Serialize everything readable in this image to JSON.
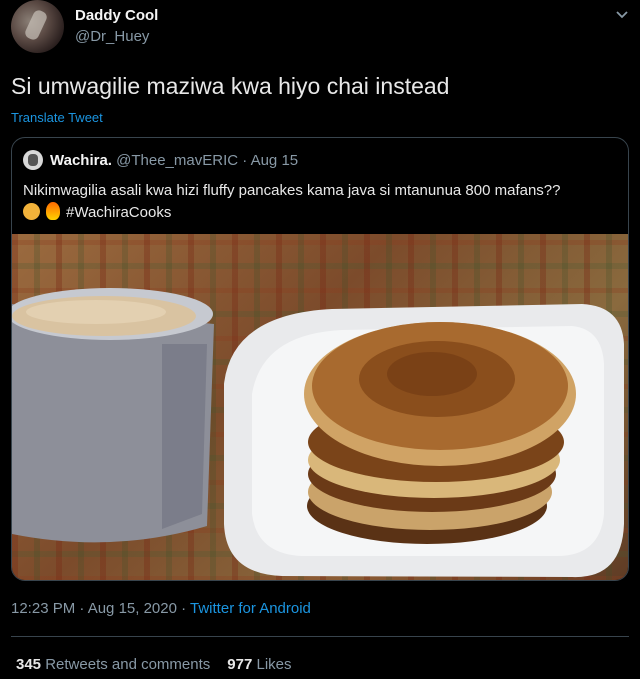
{
  "tweet": {
    "author_name": "Daddy Cool",
    "author_handle": "@Dr_Huey",
    "text": "Si umwagilie maziwa kwa hiyo chai instead",
    "translate_label": "Translate Tweet",
    "timestamp": "12:23 PM · Aug 15, 2020 · ",
    "source": "Twitter for Android"
  },
  "quoted": {
    "author_name": "Wachira.",
    "author_handle": "@Thee_mavERIC",
    "date": " · Aug 15",
    "text": "Nikimwagilia asali kwa hizi fluffy pancakes kama java si mtanunua 800 mafans??",
    "hashtag": "#WachiraCooks",
    "emoji_icons": [
      "angry-face-icon",
      "fire-icon"
    ]
  },
  "stats": {
    "retweets_count": "345",
    "retweets_label": "Retweets and comments",
    "likes_count": "977",
    "likes_label": "Likes"
  },
  "colors": {
    "background": "#000000",
    "link": "#1b95e0",
    "muted": "#8899a6",
    "border": "#38444d"
  }
}
